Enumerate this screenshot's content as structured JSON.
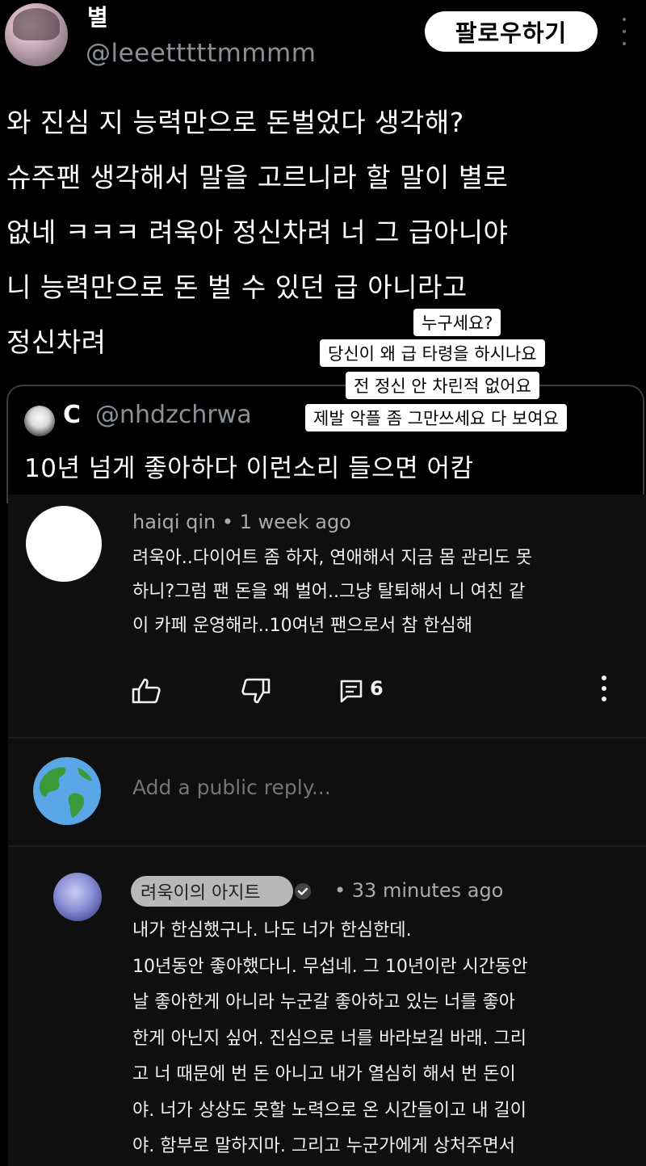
{
  "tweet": {
    "display_name": "별",
    "handle": "@leeetttttmmmm",
    "follow_label": "팔로우하기",
    "body": "와 진심 지 능력만으로 돈벌었다 생각해?\n슈주팬 생각해서 말을 고르니라 할 말이 별로\n없네 ㅋㅋㅋ 려욱아 정신차려 너 그 급아니야\n니 능력만으로 돈 벌 수 있던 급 아니라고\n정신차려"
  },
  "stickers": [
    "누구세요?",
    "당신이 왜 급 타령을 하시나요",
    "전 정신 안 차린적 없어요",
    "제발 악플 좀 그만쓰세요 다 보여요"
  ],
  "quote": {
    "name": "C",
    "handle": "@nhdzchrwa",
    "text": "10년 넘게 좋아하다 이런소리 들으면 어캄"
  },
  "comment1": {
    "meta": "haiqi qin • 1 week ago",
    "text": "려욱아..다이어트 좀 하자, 연애해서 지금 몸 관리도 못\n하니?그럼 팬 돈을 왜 벌어..그냥 탈퇴해서 니 여친 같\n이 카페 운영해라..10여년 팬으로서 참 한심해",
    "reply_count": "6"
  },
  "reply_box": {
    "placeholder": "Add a public reply..."
  },
  "comment2": {
    "author": "려욱이의 아지트",
    "time": "• 33 minutes ago",
    "text": "내가 한심했구나. 나도 너가 한심한데.\n10년동안 좋아했다니. 무섭네. 그 10년이란 시간동안\n날 좋아한게 아니라 누군갈 좋아하고 있는 너를 좋아\n한게 아닌지 싶어. 진심으로 너를 바라보길 바래. 그리\n고 너 때문에 번 돈 아니고 내가 열심히 해서 번 돈이\n야. 너가 상상도 못할 노력으로 온 시간들이고 내 길이\n야. 함부로 말하지마. 그리고 누군가에게 상처주면서"
  },
  "colors": {
    "background": "#000000",
    "panel": "#0f0f0f",
    "muted_text": "#8b9096",
    "badge": "#b8b8b8"
  },
  "icons": [
    "more-vert-icon",
    "like-icon",
    "dislike-icon",
    "reply-icon",
    "globe-icon",
    "verified-check-icon"
  ]
}
